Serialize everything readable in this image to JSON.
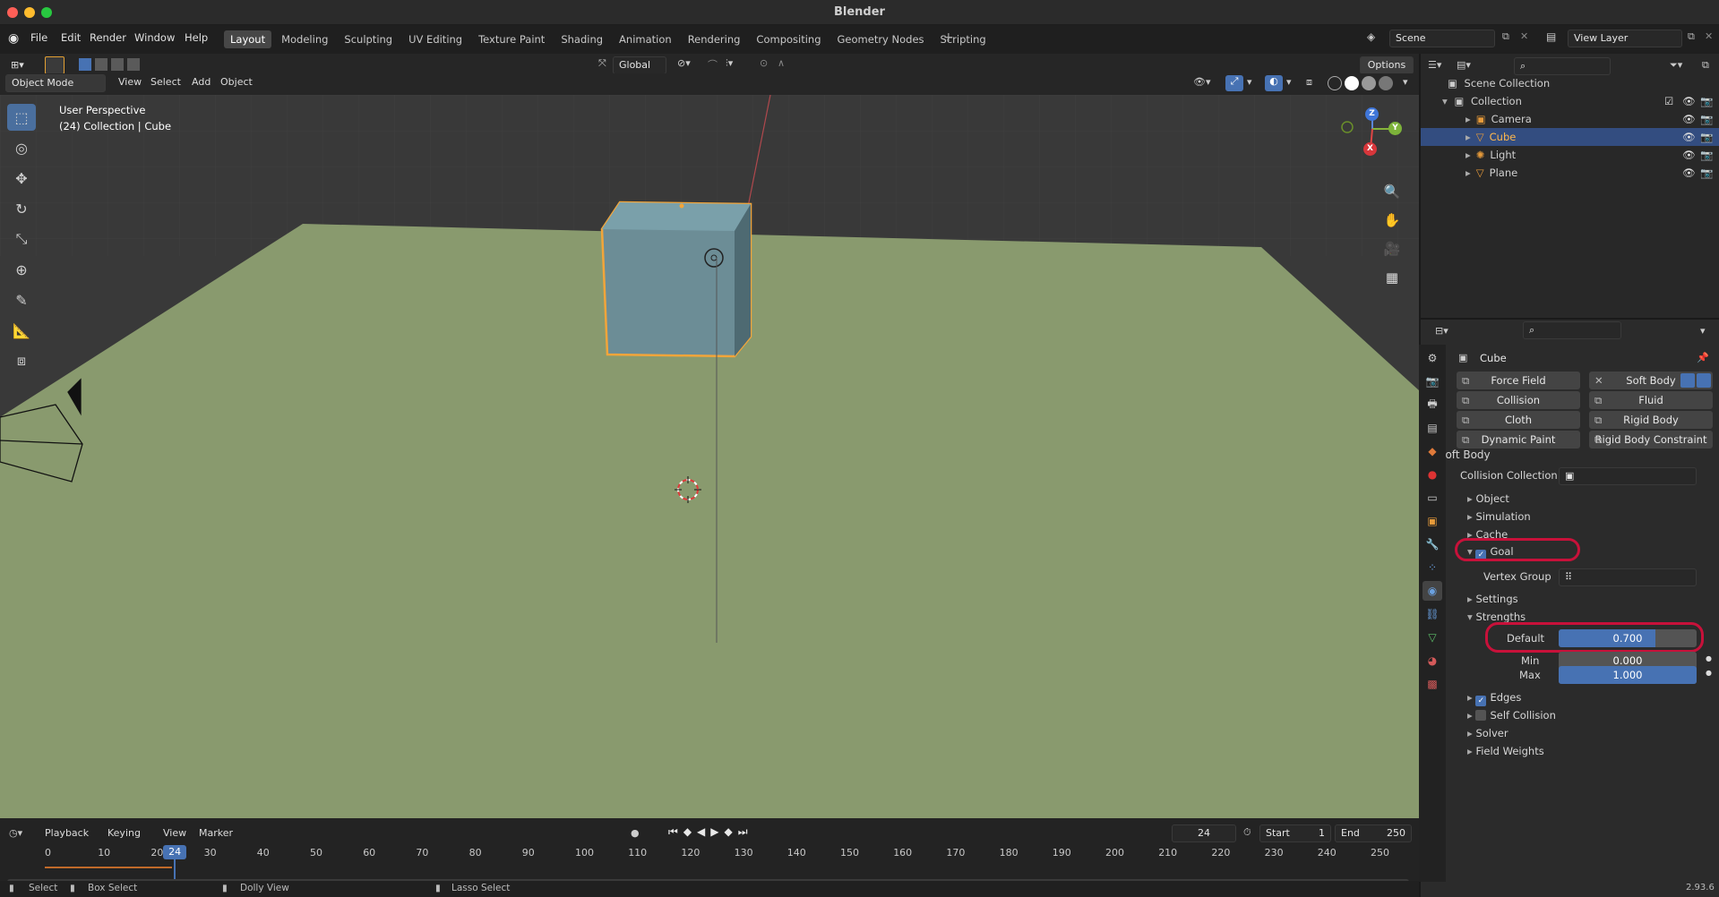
{
  "window": {
    "title": "Blender",
    "version": "2.93.6"
  },
  "menus": [
    "File",
    "Edit",
    "Render",
    "Window",
    "Help"
  ],
  "workspaces": [
    {
      "label": "Layout",
      "active": true
    },
    {
      "label": "Modeling"
    },
    {
      "label": "Sculpting"
    },
    {
      "label": "UV Editing"
    },
    {
      "label": "Texture Paint"
    },
    {
      "label": "Shading"
    },
    {
      "label": "Animation"
    },
    {
      "label": "Rendering"
    },
    {
      "label": "Compositing"
    },
    {
      "label": "Geometry Nodes"
    },
    {
      "label": "Scripting"
    }
  ],
  "scene": {
    "name": "Scene",
    "view_layer": "View Layer"
  },
  "viewport": {
    "transform_orientation": "Global",
    "options_label": "Options",
    "mode": "Object Mode",
    "menu": [
      "View",
      "Select",
      "Add",
      "Object"
    ],
    "overlay_title": "User Perspective",
    "overlay_sub": "(24) Collection | Cube",
    "gizmo": {
      "z": "Z",
      "y": "Y",
      "x": "X"
    }
  },
  "outliner": {
    "root": "Scene Collection",
    "collection": "Collection",
    "items": [
      {
        "label": "Camera",
        "selected": false,
        "icon": "camera-icon"
      },
      {
        "label": "Cube",
        "selected": true,
        "icon": "mesh-icon"
      },
      {
        "label": "Light",
        "selected": false,
        "icon": "light-icon"
      },
      {
        "label": "Plane",
        "selected": false,
        "icon": "mesh-icon"
      }
    ]
  },
  "properties": {
    "object_name": "Cube",
    "physics_buttons": [
      {
        "label": "Force Field"
      },
      {
        "label": "Soft Body",
        "enabled": true
      },
      {
        "label": "Collision"
      },
      {
        "label": "Fluid"
      },
      {
        "label": "Cloth"
      },
      {
        "label": "Rigid Body"
      },
      {
        "label": "Dynamic Paint"
      },
      {
        "label": "Rigid Body Constraint"
      }
    ],
    "softbody_header": "Soft Body",
    "collision_collection_label": "Collision Collection",
    "sub_object": "Object",
    "sub_simulation": "Simulation",
    "sub_cache": "Cache",
    "goal_label": "Goal",
    "vertex_group_label": "Vertex Group",
    "sub_settings": "Settings",
    "sub_strengths": "Strengths",
    "default_label": "Default",
    "default_value": "0.700",
    "default_fraction": 0.7,
    "min_label": "Min",
    "min_value": "0.000",
    "min_fraction": 0.0,
    "max_label": "Max",
    "max_value": "1.000",
    "max_fraction": 1.0,
    "edges_label": "Edges",
    "self_collision_label": "Self Collision",
    "solver_label": "Solver",
    "field_weights_label": "Field Weights"
  },
  "timeline": {
    "menu": [
      "Playback",
      "Keying",
      "View",
      "Marker"
    ],
    "current_frame": "24",
    "start_label": "Start",
    "start_value": "1",
    "end_label": "End",
    "end_value": "250",
    "ticks": [
      "0",
      "10",
      "20",
      "30",
      "40",
      "50",
      "60",
      "70",
      "80",
      "90",
      "100",
      "110",
      "120",
      "130",
      "140",
      "150",
      "160",
      "170",
      "180",
      "190",
      "200",
      "210",
      "220",
      "230",
      "240",
      "250"
    ]
  },
  "statusbar": {
    "select": "Select",
    "box_select": "Box Select",
    "dolly_view": "Dolly View",
    "lasso_select": "Lasso Select"
  }
}
